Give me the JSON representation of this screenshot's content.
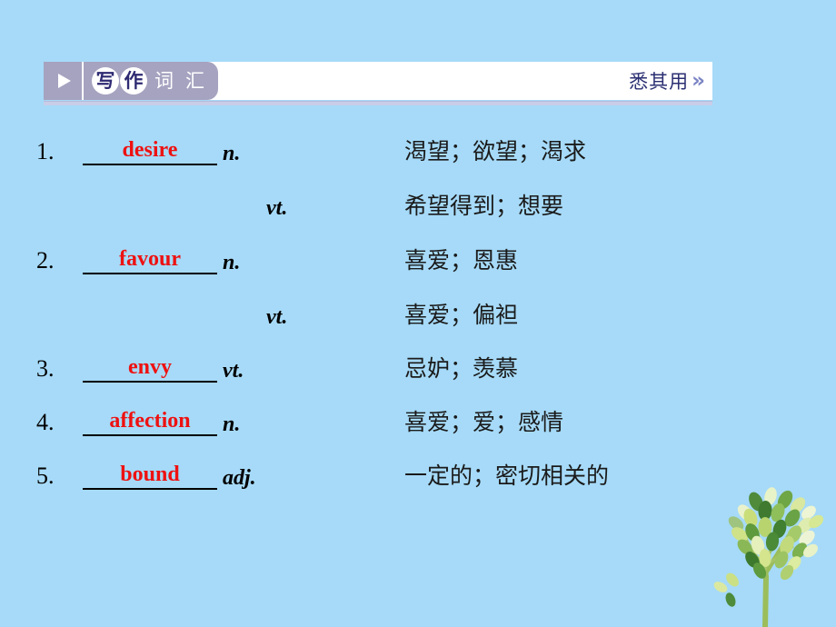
{
  "page": {
    "background_color": "#a6daf8",
    "accent_red": "#ee1111",
    "badge_color": "#a6a3c0",
    "navy": "#2b2f72"
  },
  "header": {
    "play_icon": "play-triangle-icon",
    "circled_chars": [
      "写",
      "作"
    ],
    "plain_chars": [
      "词",
      "汇"
    ],
    "title_full": "写作词汇",
    "right_label": "悉其用",
    "right_chevron": "»"
  },
  "word_list": [
    {
      "number": "1.",
      "answer": "desire",
      "lines": [
        {
          "pos": "n.",
          "meaning": "渴望；欲望；渴求"
        },
        {
          "pos": "vt.",
          "meaning": "希望得到；想要"
        }
      ]
    },
    {
      "number": "2.",
      "answer": "favour",
      "lines": [
        {
          "pos": "n.",
          "meaning": "喜爱；恩惠"
        },
        {
          "pos": "vt.",
          "meaning": "喜爱；偏袒"
        }
      ]
    },
    {
      "number": "3.",
      "answer": "envy",
      "lines": [
        {
          "pos": "vt.",
          "meaning": "忌妒；羡慕"
        }
      ]
    },
    {
      "number": "4.",
      "answer": "affection",
      "lines": [
        {
          "pos": "n.",
          "meaning": "喜爱；爱；感情"
        }
      ]
    },
    {
      "number": "5.",
      "answer": "bound",
      "lines": [
        {
          "pos": "adj.",
          "meaning": "一定的；密切相关的"
        }
      ]
    }
  ],
  "decoration": {
    "tree": "leafy-tree-icon",
    "leaf_colors": [
      "#4f8b3b",
      "#8fbf5a",
      "#c6dd7a",
      "#e3efb8",
      "#9fc48c"
    ],
    "trunk_color": "#9bbd5a"
  }
}
